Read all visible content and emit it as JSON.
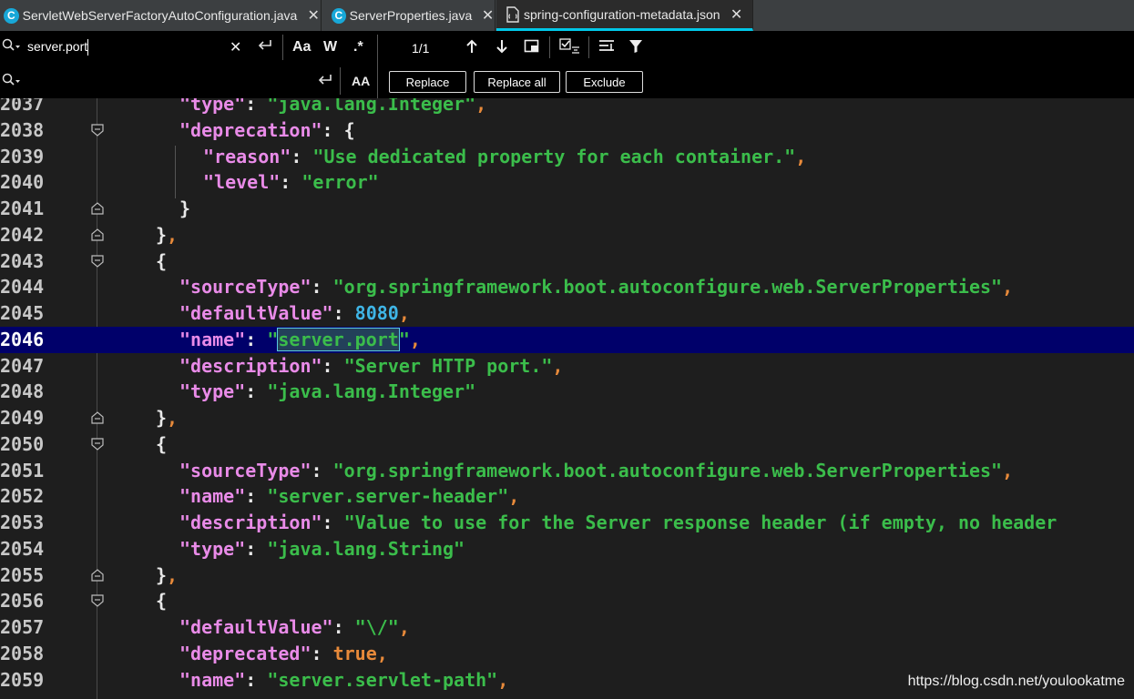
{
  "tabs": [
    {
      "label": "ServletWebServerFactoryAutoConfiguration.java",
      "icon": "java-class-icon",
      "active": false
    },
    {
      "label": "ServerProperties.java",
      "icon": "java-class-icon",
      "active": false
    },
    {
      "label": "spring-configuration-metadata.json",
      "icon": "json-file-icon",
      "active": true
    }
  ],
  "find": {
    "search_value": "server.port",
    "replace_value": "",
    "match_count": "1/1",
    "match_case": "Aa",
    "whole_word": "W",
    "regex": ".*",
    "preserve_case": "AA"
  },
  "replace_buttons": {
    "replace": "Replace",
    "replace_all": "Replace all",
    "exclude": "Exclude"
  },
  "editor": {
    "current_line": "2046",
    "lines": [
      {
        "num": "2037",
        "indent": 2,
        "tokens": [
          [
            "k",
            "\"type\""
          ],
          [
            "p",
            ": "
          ],
          [
            "s",
            "\"java.lang.Integer\""
          ],
          [
            "cm",
            ","
          ]
        ]
      },
      {
        "num": "2038",
        "indent": 2,
        "tokens": [
          [
            "k",
            "\"deprecation\""
          ],
          [
            "p",
            ": "
          ],
          [
            "p",
            "{"
          ]
        ]
      },
      {
        "num": "2039",
        "indent": 3,
        "tokens": [
          [
            "k",
            "\"reason\""
          ],
          [
            "p",
            ": "
          ],
          [
            "s",
            "\"Use dedicated property for each container.\""
          ],
          [
            "cm",
            ","
          ]
        ]
      },
      {
        "num": "2040",
        "indent": 3,
        "tokens": [
          [
            "k",
            "\"level\""
          ],
          [
            "p",
            ": "
          ],
          [
            "s",
            "\"error\""
          ]
        ]
      },
      {
        "num": "2041",
        "indent": 2,
        "tokens": [
          [
            "p",
            "}"
          ]
        ]
      },
      {
        "num": "2042",
        "indent": 1,
        "tokens": [
          [
            "p",
            "}"
          ],
          [
            "cm",
            ","
          ]
        ]
      },
      {
        "num": "2043",
        "indent": 1,
        "tokens": [
          [
            "p",
            "{"
          ]
        ]
      },
      {
        "num": "2044",
        "indent": 2,
        "tokens": [
          [
            "k",
            "\"sourceType\""
          ],
          [
            "p",
            ": "
          ],
          [
            "s",
            "\"org.springframework.boot.autoconfigure.web.ServerProperties\""
          ],
          [
            "cm",
            ","
          ]
        ]
      },
      {
        "num": "2045",
        "indent": 2,
        "tokens": [
          [
            "k",
            "\"defaultValue\""
          ],
          [
            "p",
            ": "
          ],
          [
            "n",
            "8080"
          ],
          [
            "cm",
            ","
          ]
        ]
      },
      {
        "num": "2046",
        "indent": 2,
        "tokens": [
          [
            "k",
            "\"name\""
          ],
          [
            "p",
            ": "
          ],
          [
            "s",
            "\""
          ],
          [
            "hl",
            "server.port"
          ],
          [
            "s",
            "\""
          ],
          [
            "cm",
            ","
          ]
        ]
      },
      {
        "num": "2047",
        "indent": 2,
        "tokens": [
          [
            "k",
            "\"description\""
          ],
          [
            "p",
            ": "
          ],
          [
            "s",
            "\"Server HTTP port.\""
          ],
          [
            "cm",
            ","
          ]
        ]
      },
      {
        "num": "2048",
        "indent": 2,
        "tokens": [
          [
            "k",
            "\"type\""
          ],
          [
            "p",
            ": "
          ],
          [
            "s",
            "\"java.lang.Integer\""
          ]
        ]
      },
      {
        "num": "2049",
        "indent": 1,
        "tokens": [
          [
            "p",
            "}"
          ],
          [
            "cm",
            ","
          ]
        ]
      },
      {
        "num": "2050",
        "indent": 1,
        "tokens": [
          [
            "p",
            "{"
          ]
        ]
      },
      {
        "num": "2051",
        "indent": 2,
        "tokens": [
          [
            "k",
            "\"sourceType\""
          ],
          [
            "p",
            ": "
          ],
          [
            "s",
            "\"org.springframework.boot.autoconfigure.web.ServerProperties\""
          ],
          [
            "cm",
            ","
          ]
        ]
      },
      {
        "num": "2052",
        "indent": 2,
        "tokens": [
          [
            "k",
            "\"name\""
          ],
          [
            "p",
            ": "
          ],
          [
            "s",
            "\"server.server-header\""
          ],
          [
            "cm",
            ","
          ]
        ]
      },
      {
        "num": "2053",
        "indent": 2,
        "tokens": [
          [
            "k",
            "\"description\""
          ],
          [
            "p",
            ": "
          ],
          [
            "s",
            "\"Value to use for the Server response header (if empty, no header"
          ]
        ]
      },
      {
        "num": "2054",
        "indent": 2,
        "tokens": [
          [
            "k",
            "\"type\""
          ],
          [
            "p",
            ": "
          ],
          [
            "s",
            "\"java.lang.String\""
          ]
        ]
      },
      {
        "num": "2055",
        "indent": 1,
        "tokens": [
          [
            "p",
            "}"
          ],
          [
            "cm",
            ","
          ]
        ]
      },
      {
        "num": "2056",
        "indent": 1,
        "tokens": [
          [
            "p",
            "{"
          ]
        ]
      },
      {
        "num": "2057",
        "indent": 2,
        "tokens": [
          [
            "k",
            "\"defaultValue\""
          ],
          [
            "p",
            ": "
          ],
          [
            "s",
            "\"\\/\""
          ],
          [
            "cm",
            ","
          ]
        ]
      },
      {
        "num": "2058",
        "indent": 2,
        "tokens": [
          [
            "k",
            "\"deprecated\""
          ],
          [
            "p",
            ": "
          ],
          [
            "b",
            "true"
          ],
          [
            "cm",
            ","
          ]
        ]
      },
      {
        "num": "2059",
        "indent": 2,
        "tokens": [
          [
            "k",
            "\"name\""
          ],
          [
            "p",
            ": "
          ],
          [
            "s",
            "\"server.servlet-path\""
          ],
          [
            "cm",
            ","
          ]
        ]
      }
    ]
  },
  "watermark": "https://blog.csdn.net/youlookatme"
}
